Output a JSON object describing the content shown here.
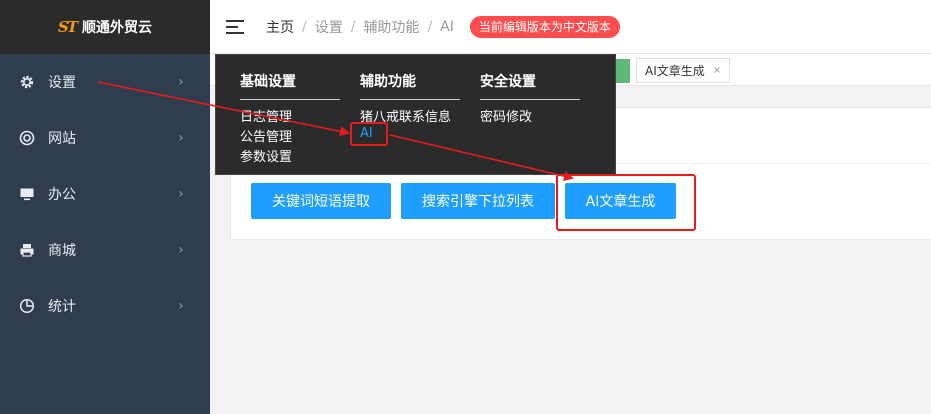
{
  "app": {
    "logo_mark": "ST",
    "title": "顺通外贸云"
  },
  "sidebar": {
    "items": [
      {
        "label": "设置",
        "icon": "gear-icon"
      },
      {
        "label": "网站",
        "icon": "lifebuoy-icon"
      },
      {
        "label": "办公",
        "icon": "monitor-icon"
      },
      {
        "label": "商城",
        "icon": "printer-icon"
      },
      {
        "label": "统计",
        "icon": "pie-chart-icon"
      }
    ],
    "chevron": "›"
  },
  "header": {
    "breadcrumb": [
      "主页",
      "设置",
      "辅助功能",
      "AI"
    ],
    "separator": "/",
    "badge": "当前编辑版本为中文版本"
  },
  "tabs": [
    {
      "label": "AI文章生成",
      "close": "×"
    }
  ],
  "dropdown": {
    "columns": [
      {
        "title": "基础设置",
        "items": [
          "日志管理",
          "公告管理",
          "参数设置"
        ]
      },
      {
        "title": "辅助功能",
        "items": [
          "猪八戒联系信息",
          "AI"
        ],
        "active_index": 1
      },
      {
        "title": "安全设置",
        "items": [
          "密码修改"
        ]
      }
    ]
  },
  "buttons": [
    "关键词短语提取",
    "搜索引擎下拉列表",
    "AI文章生成"
  ],
  "colors": {
    "sidebar": "#2f3d4f",
    "primary": "#1e9fff",
    "annotation": "#e81c1c",
    "badge": "#ff4d4f"
  }
}
